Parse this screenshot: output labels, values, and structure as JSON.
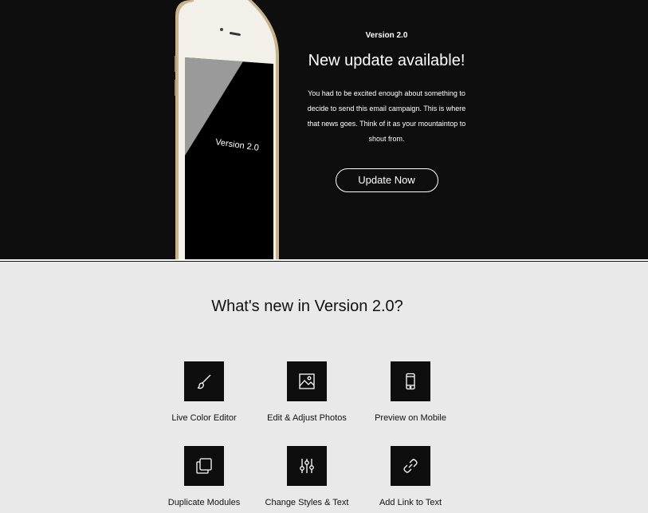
{
  "hero": {
    "phone_screen_text": "Version 2.0",
    "version_tag": "Version 2.0",
    "title": "New update available!",
    "body": "You had to be excited enough about something to decide to send this email campaign. This is where that news goes. Think of it as your mountaintop to shout from.",
    "button_label": "Update Now",
    "background": "#0e0e0e"
  },
  "features": {
    "title": "What's new in Version 2.0?",
    "items": [
      {
        "label": "Live Color Editor",
        "icon": "paintbrush-icon"
      },
      {
        "label": "Edit & Adjust Photos",
        "icon": "image-icon"
      },
      {
        "label": "Preview on Mobile",
        "icon": "mobile-phone-icon"
      },
      {
        "label": "Duplicate Modules",
        "icon": "duplicate-icon"
      },
      {
        "label": "Change Styles & Text",
        "icon": "sliders-icon"
      },
      {
        "label": "Add Link to Text",
        "icon": "link-icon"
      }
    ],
    "background": "#e9e9e9"
  }
}
